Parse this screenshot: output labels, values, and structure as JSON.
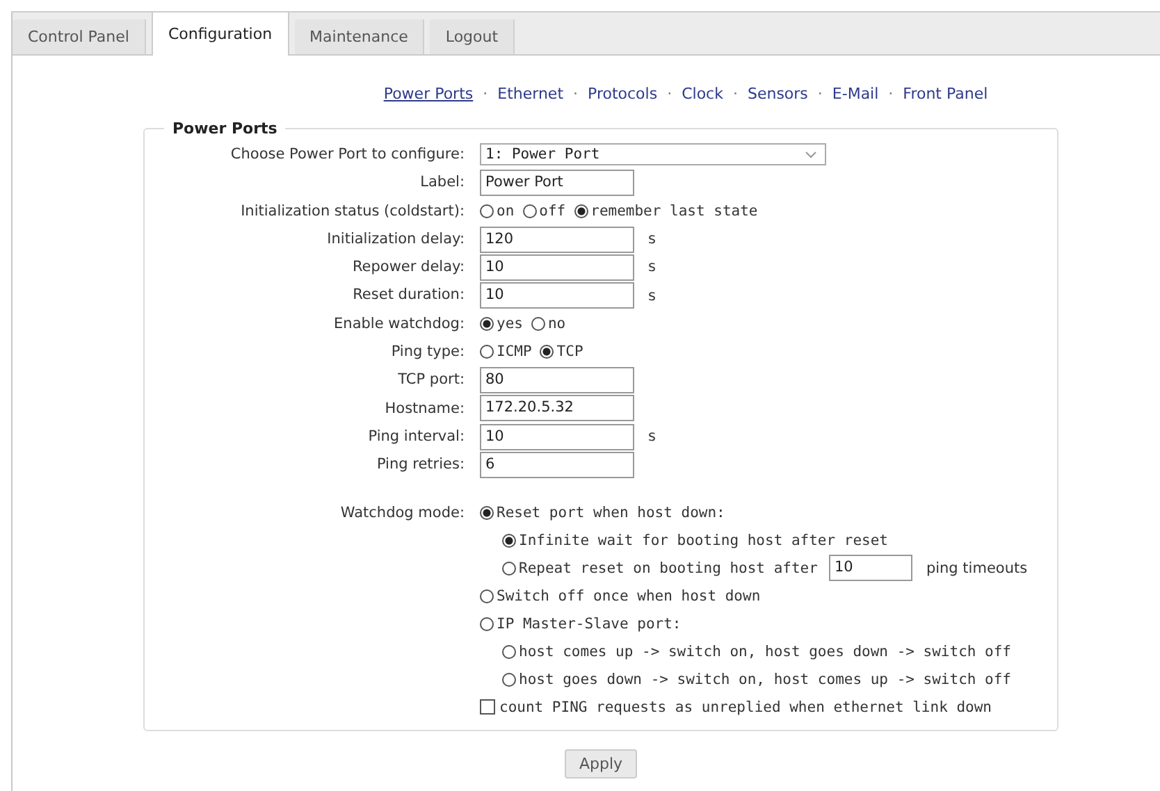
{
  "tabs": [
    {
      "label": "Control Panel",
      "selected": false
    },
    {
      "label": "Configuration",
      "selected": true
    },
    {
      "label": "Maintenance",
      "selected": false
    },
    {
      "label": "Logout",
      "selected": false
    }
  ],
  "subnav": [
    {
      "label": "Power Ports",
      "selected": true
    },
    {
      "label": "Ethernet",
      "selected": false
    },
    {
      "label": "Protocols",
      "selected": false
    },
    {
      "label": "Clock",
      "selected": false
    },
    {
      "label": "Sensors",
      "selected": false
    },
    {
      "label": "E-Mail",
      "selected": false
    },
    {
      "label": "Front Panel",
      "selected": false
    }
  ],
  "separator": "·",
  "panel": {
    "legend": "Power Ports",
    "fields": [
      {
        "kind": "select",
        "label": "Choose Power Port to configure:",
        "value": "1: Power Port"
      },
      {
        "kind": "text",
        "label": "Label:",
        "value": "Power Port"
      },
      {
        "kind": "radio",
        "label": "Initialization status (coldstart):",
        "options": [
          {
            "label": "on",
            "selected": false
          },
          {
            "label": "off",
            "selected": false
          },
          {
            "label": "remember last state",
            "selected": true
          }
        ]
      },
      {
        "kind": "text",
        "label": "Initialization delay:",
        "value": "120",
        "unit": "s"
      },
      {
        "kind": "text",
        "label": "Repower delay:",
        "value": "10",
        "unit": "s"
      },
      {
        "kind": "text",
        "label": "Reset duration:",
        "value": "10",
        "unit": "s"
      },
      {
        "kind": "radio",
        "label": "Enable watchdog:",
        "options": [
          {
            "label": "yes",
            "selected": true
          },
          {
            "label": "no",
            "selected": false
          }
        ]
      },
      {
        "kind": "radio",
        "label": "Ping type:",
        "options": [
          {
            "label": "ICMP",
            "selected": false
          },
          {
            "label": "TCP",
            "selected": true
          }
        ]
      },
      {
        "kind": "text",
        "label": "TCP port:",
        "value": "80"
      },
      {
        "kind": "text",
        "label": "Hostname:",
        "value": "172.20.5.32"
      },
      {
        "kind": "text",
        "label": "Ping interval:",
        "value": "10",
        "unit": "s"
      },
      {
        "kind": "text",
        "label": "Ping retries:",
        "value": "6"
      }
    ],
    "watchdog_mode": {
      "label": "Watchdog mode:",
      "options": [
        {
          "label": "Reset port when host down:",
          "selected": true,
          "children": [
            {
              "label": "Infinite wait for booting host after reset",
              "selected": true
            },
            {
              "label": "Repeat reset on booting host after",
              "selected": false,
              "value": "10",
              "suffix": "ping timeouts"
            }
          ]
        },
        {
          "label": "Switch off once when host down",
          "selected": false
        },
        {
          "label": "IP Master-Slave port:",
          "selected": false,
          "children": [
            {
              "label": "host comes up -> switch on, host goes down -> switch off",
              "selected": false
            },
            {
              "label": "host goes down -> switch on, host comes up -> switch off",
              "selected": false
            }
          ]
        }
      ],
      "checkbox": {
        "label": "count PING requests as unreplied when ethernet link down",
        "checked": false
      }
    }
  },
  "apply": "Apply"
}
